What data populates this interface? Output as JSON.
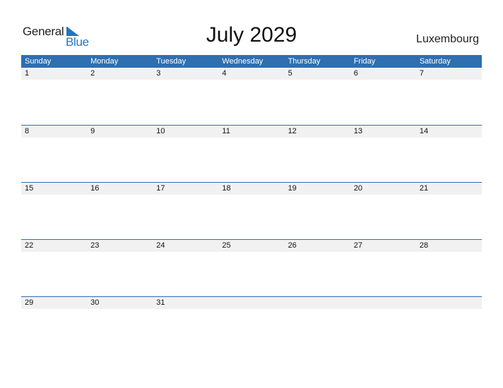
{
  "logo": {
    "part1": "General",
    "part2": "Blue"
  },
  "title": "July 2029",
  "country": "Luxembourg",
  "colors": {
    "header_bg": "#2e6fb0",
    "row_bg": "#f1f1f1",
    "logo_blue": "#1f76c2"
  },
  "weekdays": [
    "Sunday",
    "Monday",
    "Tuesday",
    "Wednesday",
    "Thursday",
    "Friday",
    "Saturday"
  ],
  "weeks": [
    [
      "1",
      "2",
      "3",
      "4",
      "5",
      "6",
      "7"
    ],
    [
      "8",
      "9",
      "10",
      "11",
      "12",
      "13",
      "14"
    ],
    [
      "15",
      "16",
      "17",
      "18",
      "19",
      "20",
      "21"
    ],
    [
      "22",
      "23",
      "24",
      "25",
      "26",
      "27",
      "28"
    ],
    [
      "29",
      "30",
      "31",
      "",
      "",
      "",
      ""
    ]
  ]
}
